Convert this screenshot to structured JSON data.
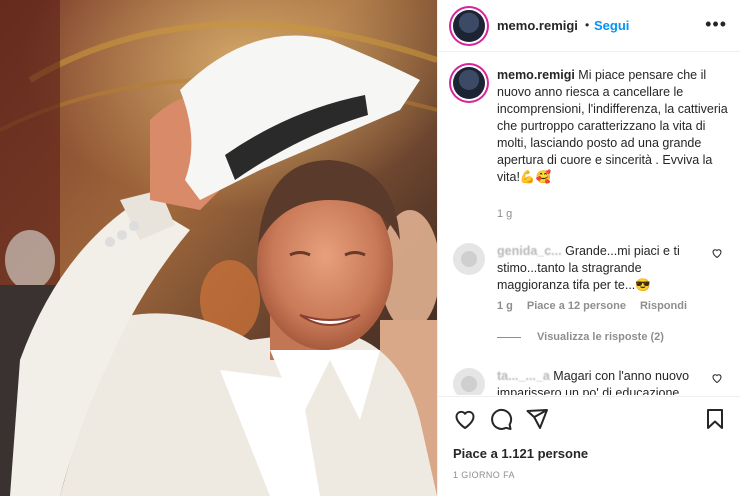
{
  "post": {
    "username": "memo.remigi",
    "separator": "•",
    "follow_label": "Segui",
    "more_icon": "more-horizontal-icon",
    "caption": "Mi piace pensare che il nuovo anno riesca a cancellare le incomprensioni, l'indifferenza, la cattiveria che purtroppo caratterizzano la vita di molti, lasciando posto ad una grande apertura di cuore e sincerità . Evviva la vita!💪🥰",
    "caption_time": "1 g",
    "likes": "Piace a 1.121 persone",
    "posted_ago": "1 GIORNO FA"
  },
  "comments": [
    {
      "username": "genida_c...",
      "text": "Grande...mi piaci e ti stimo...tanto la stragrande maggioranza tifa per te...😎",
      "time": "1 g",
      "likes": "Piace a 12 persone",
      "reply_label": "Rispondi",
      "view_replies": "Visualizza le risposte (2)"
    },
    {
      "username": "ta..._..._a",
      "text": "Magari con l'anno nuovo imparissero un po' di educazione"
    }
  ],
  "icons": {
    "like": "heart-icon",
    "comment": "comment-icon",
    "share": "send-icon",
    "save": "bookmark-icon"
  },
  "colors": {
    "accent": "#0095f6",
    "muted": "#8e8e8e",
    "text": "#262626"
  }
}
